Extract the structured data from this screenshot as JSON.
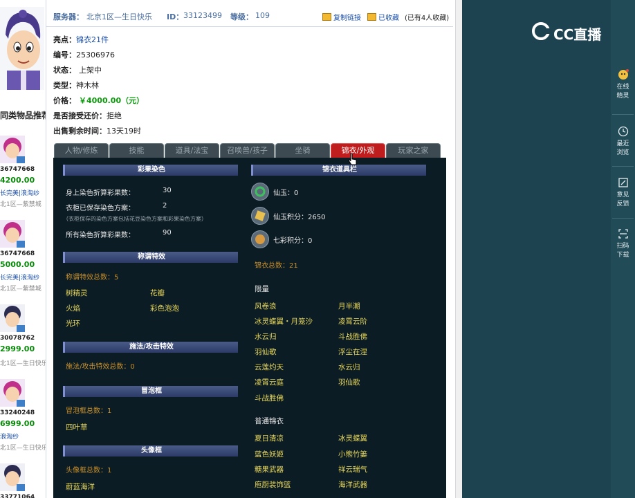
{
  "header": {
    "server_label": "服务器：",
    "server_value": "北京1区—生日快乐",
    "id_label": "ID：",
    "id_value": "33123499",
    "level_label": "等级：",
    "level_value": "109",
    "copy_link": "复制链接",
    "favorited": "已收藏",
    "favorite_count": "(已有4人收藏)"
  },
  "info": {
    "highlight_label": "亮点：",
    "highlight_value": "锦衣21件",
    "serial_label": "编号：",
    "serial_value": "25306976",
    "status_label": "状态：",
    "status_value": "上架中",
    "type_label": "类型：",
    "type_value": "神木林",
    "price_label": "价格：",
    "price_value": "￥4000.00（元）",
    "bargain_label": "是否接受还价：",
    "bargain_value": "拒绝",
    "remaining_label": "出售剩余时间：",
    "remaining_value": "13天19时"
  },
  "tabs": [
    "人物/修炼",
    "技能",
    "道具/法宝",
    "召唤兽/孩子",
    "坐骑",
    "锦衣/外观",
    "玩家之家"
  ],
  "active_tab": "锦衣/外观",
  "panel": {
    "dye": {
      "header": "彩果染色",
      "body_dye_label": "身上染色折算彩果数：",
      "body_dye_value": "30",
      "wardrobe_label": "衣柜已保存染色方案：",
      "wardrobe_value": "2",
      "note": "（衣柜保存的染色方案包括花豆染色方案和彩果染色方案）",
      "total_label": "所有染色折算彩果数：",
      "total_value": "90"
    },
    "title_fx": {
      "header": "称谓特效",
      "count": "称谓特效总数：5",
      "items": [
        "树精灵",
        "花瓣",
        "火焰",
        "彩色泡泡",
        "光环"
      ]
    },
    "spell_fx": {
      "header": "施法/攻击特效",
      "count": "施法/攻击特效总数：0"
    },
    "bubble": {
      "header": "冒泡框",
      "count": "冒泡框总数：1",
      "items": [
        "四叶草"
      ]
    },
    "avatar_frame": {
      "header": "头像框",
      "count": "头像框总数：1",
      "items": [
        "蔚蓝海洋"
      ]
    },
    "jinyi": {
      "header": "锦衣道具栏",
      "xianyu": "仙玉：0",
      "xianyu_points": "仙玉积分：2650",
      "qicai_points": "七彩积分：0",
      "total": "锦衣总数：21",
      "limited_label": "限量",
      "limited_items": [
        "风卷浪",
        "月半潮",
        "冰灵蝶翼・月笼沙",
        "凌霄云阶",
        "水云归",
        "斗战胜佛",
        "羽仙歌",
        "浮尘在涅",
        "云莲灼天",
        "水云归",
        "凌霄云庭",
        "羽仙歌",
        "斗战胜佛"
      ],
      "normal_label": "普通锦衣",
      "normal_items": [
        "夏日清凉",
        "冰灵蝶翼",
        "蓝色妖姬",
        "小熊竹篓",
        "糖果武器",
        "祥云瑞气",
        "庖厨装饰篮",
        "海洋武器"
      ]
    }
  },
  "left": {
    "recommend_title": "同类物品推荐",
    "items": [
      {
        "id": "36747668",
        "price": "4200.00",
        "seller": "长完美|浪淘纱",
        "server": "北1区—紫禁城"
      },
      {
        "id": "36747668",
        "price": "5000.00",
        "seller": "长完美|浪淘纱",
        "server": "北1区—紫禁城"
      },
      {
        "id": "30078762",
        "price": "2999.00",
        "seller": "",
        "server": "北1区—生日快乐"
      },
      {
        "id": "33240248",
        "price": "6999.00",
        "seller": "浪淘纱",
        "server": "北1区—生日快乐"
      },
      {
        "id": "33771064",
        "price": "",
        "seller": "",
        "server": ""
      }
    ]
  },
  "right": {
    "logo": "CC直播",
    "items": [
      {
        "label1": "在线",
        "label2": "精灵",
        "icon": "sprite-icon"
      },
      {
        "label1": "最近",
        "label2": "浏览",
        "icon": "clock-icon"
      },
      {
        "label1": "意见",
        "label2": "反馈",
        "icon": "feedback-icon"
      },
      {
        "label1": "扫码",
        "label2": "下载",
        "icon": "qrcode-icon"
      }
    ]
  },
  "colors": {
    "panel_bg": "#0c1c24",
    "active_tab": "#c01e1e",
    "gold_text": "#c8902c",
    "yellow_text": "#e8d85c",
    "price_green": "#0a9a0a",
    "right_bg": "#1e4350"
  }
}
